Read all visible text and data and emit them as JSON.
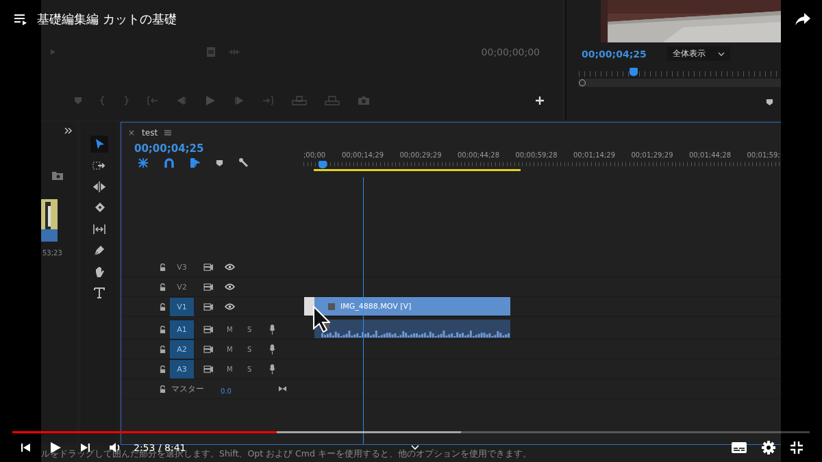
{
  "player": {
    "title": "基礎編集編 カットの基礎",
    "time": "2:53 / 8:41",
    "progress": {
      "level": 0.332
    },
    "buffered": {
      "level": 0.563
    }
  },
  "source_monitor": {
    "timecode": "00;00;00;00"
  },
  "program_monitor": {
    "timecode": "00;00;04;25",
    "zoom": "全体表示",
    "playhead": {
      "level": 0.27
    }
  },
  "project_panel": {
    "duration": "53;23"
  },
  "tools": [
    {
      "kind": "selection",
      "selected": true
    },
    {
      "kind": "track-select",
      "selected": false
    },
    {
      "kind": "ripple",
      "selected": false
    },
    {
      "kind": "razor",
      "selected": false
    },
    {
      "kind": "slip",
      "selected": false
    },
    {
      "kind": "pen",
      "selected": false
    },
    {
      "kind": "hand",
      "selected": false
    },
    {
      "kind": "type",
      "selected": false
    }
  ],
  "timeline": {
    "close": "×",
    "tab": "test",
    "timecode": "00;00;04;25",
    "ruler": [
      ";00;00",
      "00;00;14;29",
      "00;00;29;29",
      "00;00;44;28",
      "00;00;59;28",
      "00;01;14;29",
      "00;01;29;29",
      "00;01;44;28",
      "00;01;59;"
    ],
    "tracks": [
      {
        "kind": "video",
        "name": "V3",
        "targeted": false
      },
      {
        "kind": "video",
        "name": "V2",
        "targeted": false
      },
      {
        "kind": "video",
        "name": "V1",
        "targeted": true
      },
      {
        "kind": "audio",
        "name": "A1",
        "targeted": true,
        "mute": "M",
        "solo": "S"
      },
      {
        "kind": "audio",
        "name": "A2",
        "targeted": true,
        "mute": "M",
        "solo": "S"
      },
      {
        "kind": "audio",
        "name": "A3",
        "targeted": true,
        "mute": "M",
        "solo": "S"
      },
      {
        "kind": "master",
        "name": "マスター",
        "value": "0.0"
      }
    ],
    "clips": [
      {
        "kind": "video",
        "name": "IMG_4888.MOV [V]"
      },
      {
        "kind": "audio"
      }
    ]
  },
  "status_text": "ルをドラッグして囲んだ部分を選択します。Shift、Opt および Cmd キーを使用すると、他のオプションを使用できます。"
}
